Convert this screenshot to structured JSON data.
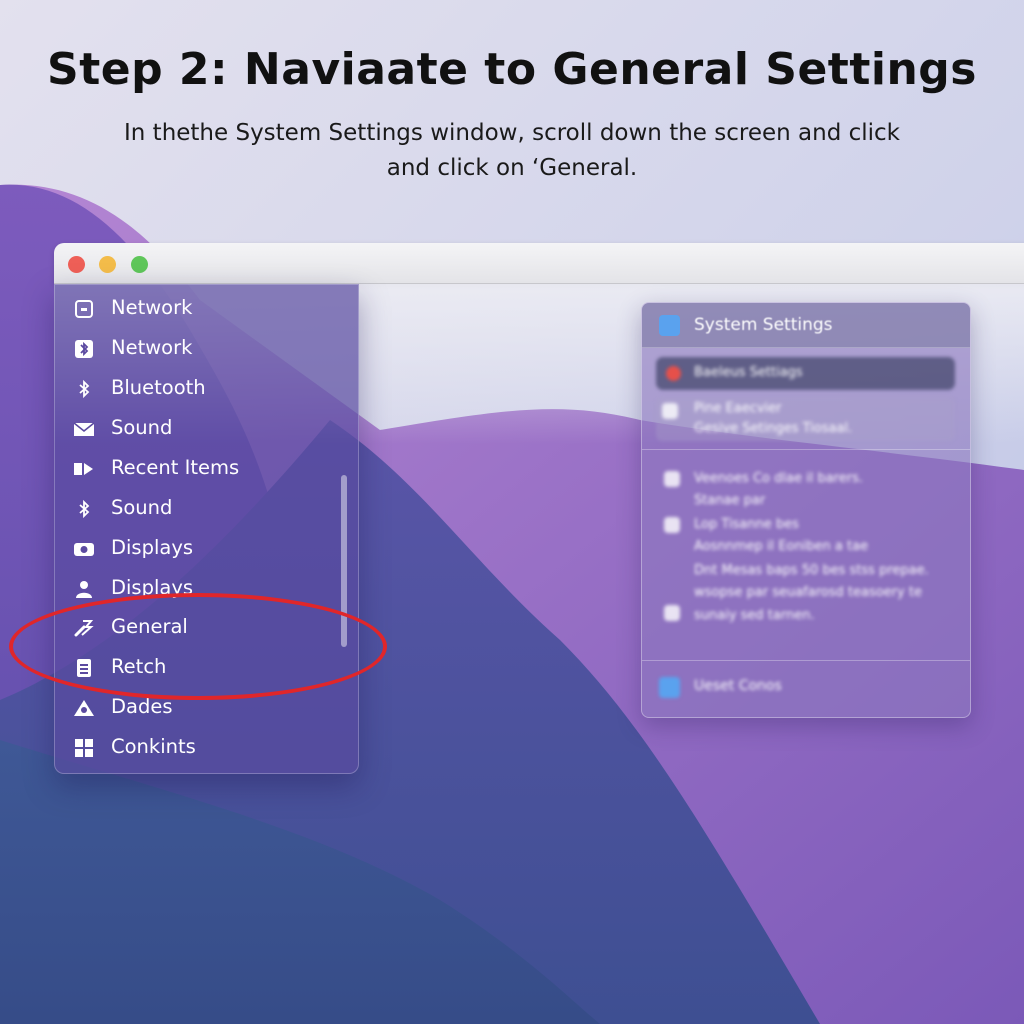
{
  "instruction": {
    "heading": "Step 2: Naviaate to General Settings",
    "line1": "In thethe System Settings window, scroll down the screen and click",
    "line2": "and click on ‘General."
  },
  "sidebar": {
    "items": [
      {
        "label": "Network",
        "icon": "network-icon"
      },
      {
        "label": "Network",
        "icon": "bluetooth-box-icon"
      },
      {
        "label": "Bluetooth",
        "icon": "bluetooth-icon"
      },
      {
        "label": "Sound",
        "icon": "envelope-icon"
      },
      {
        "label": "Recent Items",
        "icon": "arrow-icon"
      },
      {
        "label": "Sound",
        "icon": "bluetooth-icon"
      },
      {
        "label": "Displays",
        "icon": "camera-icon"
      },
      {
        "label": "Displays",
        "icon": "person-icon"
      },
      {
        "label": "General",
        "icon": "wrench-icon"
      },
      {
        "label": "Retch",
        "icon": "list-icon"
      },
      {
        "label": "Dades",
        "icon": "eye-triangle-icon"
      },
      {
        "label": "Conkints",
        "icon": "grid-icon"
      }
    ]
  },
  "highlight": {
    "target": "General",
    "color": "#e0262a"
  },
  "panel": {
    "title": "System Settings",
    "selected_row": "Baeleus Settiags",
    "box_line1": "Pine Eaecvier",
    "box_line2": "Gesive Setinges Tiosaal.",
    "text_line1": "Veenoes Co dlae il barers.",
    "text_line2": "Stanae par",
    "text_line3": "Lop Tisanne bes",
    "text_line4": "Aosnnmep il Eoniben a tae",
    "text_line5": "Dnt Mesas baps 50 bes stss prepae.",
    "text_line6": "wsopse par seuafarosd teasoery te",
    "text_line7": "sunaiy sed tarnen.",
    "footer": "Ueset Conos"
  },
  "colors": {
    "traffic_red": "#ee5f57",
    "traffic_yellow": "#f3bc4a",
    "traffic_green": "#5fc65a",
    "accent_blue": "#5aa2ee"
  }
}
